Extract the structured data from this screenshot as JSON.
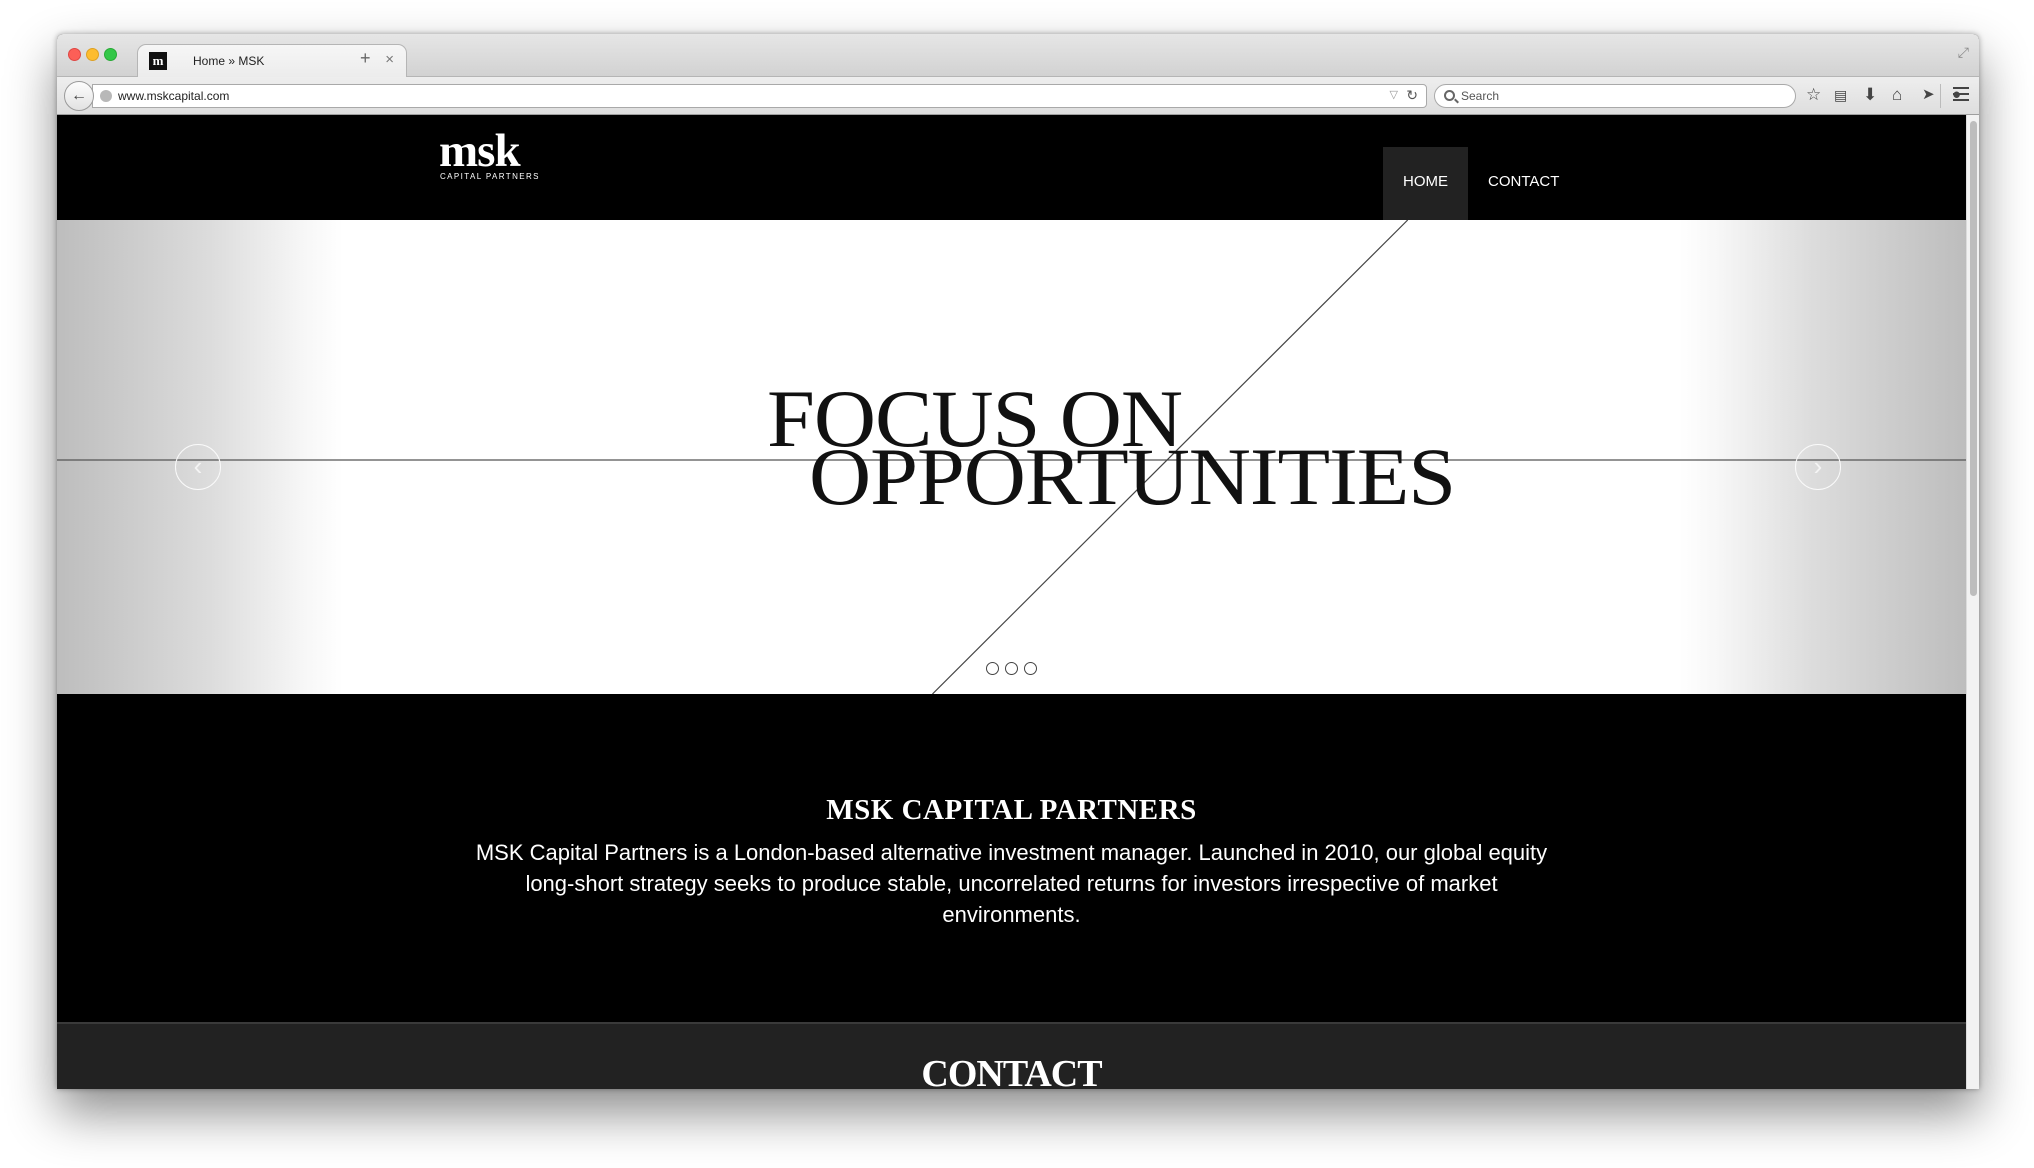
{
  "browser": {
    "tab_title": "Home » MSK",
    "tab_favicon": "m",
    "tab_close": "×",
    "new_tab": "+",
    "url": "www.mskcapital.com",
    "search_placeholder": "Search",
    "toolbar_icons": [
      "bookmark-star-icon",
      "reading-list-icon",
      "download-icon",
      "home-icon",
      "send-icon",
      "chat-icon",
      "menu-icon"
    ]
  },
  "site": {
    "logo_main": "msk",
    "logo_sub": "CAPITAL PARTNERS",
    "nav": [
      {
        "label": "HOME",
        "active": true
      },
      {
        "label": "CONTACT",
        "active": false
      }
    ]
  },
  "hero": {
    "title_line1": "FOCUS ON",
    "title_line2": "OPPORTUNITIES",
    "prev_arrow": "‹",
    "next_arrow": "›",
    "slide_count": 3
  },
  "about": {
    "heading": "MSK CAPITAL PARTNERS",
    "text": "MSK Capital Partners  is a London-based alternative investment manager. Launched in 2010, our global equity long-short strategy  seeks to produce stable, uncorrelated returns for investors irrespective of market environments."
  },
  "contact": {
    "heading": "CONTACT"
  }
}
